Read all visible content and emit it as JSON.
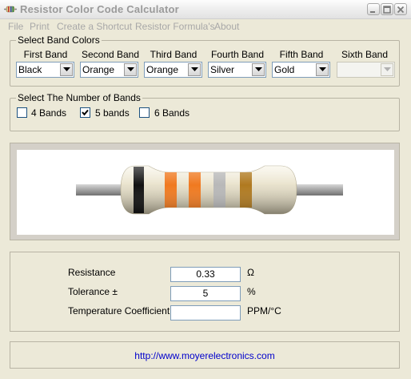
{
  "window": {
    "title": "Resistor Color Code Calculator"
  },
  "menu": {
    "items": [
      "File",
      "Print",
      "Create a Shortcut",
      "Resistor Formula's",
      "About"
    ]
  },
  "band_colors": {
    "legend": "Select Band Colors",
    "bands": [
      {
        "label": "First Band",
        "value": "Black"
      },
      {
        "label": "Second Band",
        "value": "Orange"
      },
      {
        "label": "Third Band",
        "value": "Orange"
      },
      {
        "label": "Fourth Band",
        "value": "Silver"
      },
      {
        "label": "Fifth Band",
        "value": "Gold"
      },
      {
        "label": "Sixth Band",
        "value": ""
      }
    ]
  },
  "band_count": {
    "legend": "Select The Number of Bands",
    "options": [
      {
        "label": "4 Bands",
        "checked": false
      },
      {
        "label": "5 bands",
        "checked": true
      },
      {
        "label": "6 Bands",
        "checked": false
      }
    ]
  },
  "resistor": {
    "body_color": "#e8e2cc",
    "lead_color": "#9a9a9a",
    "band_colors": [
      "#111111",
      "#f07a20",
      "#f07a20",
      "#b8b8b8",
      "#b07a20"
    ]
  },
  "results": {
    "resistance_label": "Resistance",
    "resistance_value": "0.33",
    "resistance_unit": "Ω",
    "tolerance_label": "Tolerance ±",
    "tolerance_value": "5",
    "tolerance_unit": "%",
    "tempco_label": "Temperature Coefficient",
    "tempco_value": "",
    "tempco_unit": "PPM/°C"
  },
  "footer": {
    "link": "http://www.moyerelectronics.com"
  }
}
